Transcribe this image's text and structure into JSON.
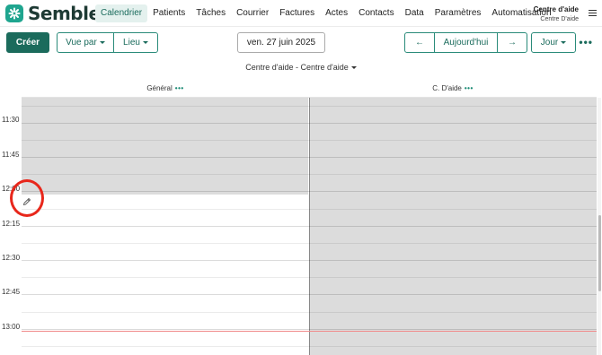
{
  "brand": {
    "name": "Semble",
    "accent": "#1b6b5c",
    "logo_color": "#1fa58f"
  },
  "nav": {
    "items": [
      {
        "label": "Calendrier",
        "active": true
      },
      {
        "label": "Patients"
      },
      {
        "label": "Tâches"
      },
      {
        "label": "Courrier"
      },
      {
        "label": "Factures"
      },
      {
        "label": "Actes"
      },
      {
        "label": "Contacts"
      },
      {
        "label": "Data"
      },
      {
        "label": "Paramètres"
      },
      {
        "label": "Automatisation"
      }
    ]
  },
  "account": {
    "name": "Centre d'aide",
    "subtitle": "Centre D'aide"
  },
  "toolbar": {
    "create_label": "Créer",
    "view_by_label": "Vue par",
    "place_label": "Lieu",
    "date_label": "ven. 27 juin 2025",
    "prev_icon": "←",
    "today_label": "Aujourd'hui",
    "next_icon": "→",
    "range_label": "Jour",
    "more_icon": "•••"
  },
  "location_label": "Centre d'aide - Centre d'aide",
  "columns": [
    {
      "name": "Général",
      "dots": "•••"
    },
    {
      "name": "C. D'aide",
      "dots": "•••"
    }
  ],
  "times": [
    "11:30",
    "11:45",
    "12:00",
    "12:15",
    "12:30",
    "12:45",
    "13:00"
  ],
  "colors": {
    "unavailable": "#dcdcdc",
    "now_line": "#f08a8a",
    "marker": "#e8271b"
  }
}
